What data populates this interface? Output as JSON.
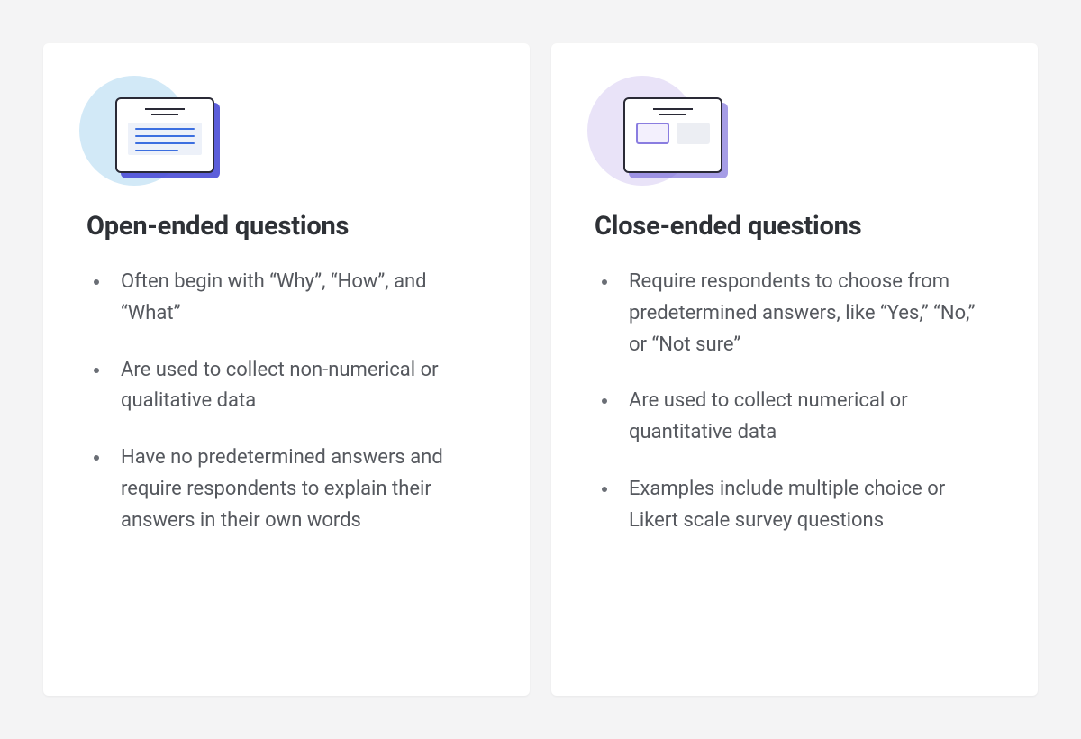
{
  "cards": [
    {
      "title": "Open-ended questions",
      "points": [
        "Often begin with “Why”, “How”, and “What”",
        "Are used to collect non-numerical or qualitative data",
        "Have no predetermined answers and require respondents to explain their answers in their own words"
      ]
    },
    {
      "title": "Close-ended questions",
      "points": [
        "Require respondents to choose from predetermined answers, like “Yes,” “No,” or “Not sure”",
        "Are used to collect numerical or quantitative data",
        "Examples include multiple choice or Likert scale survey questions"
      ]
    }
  ]
}
